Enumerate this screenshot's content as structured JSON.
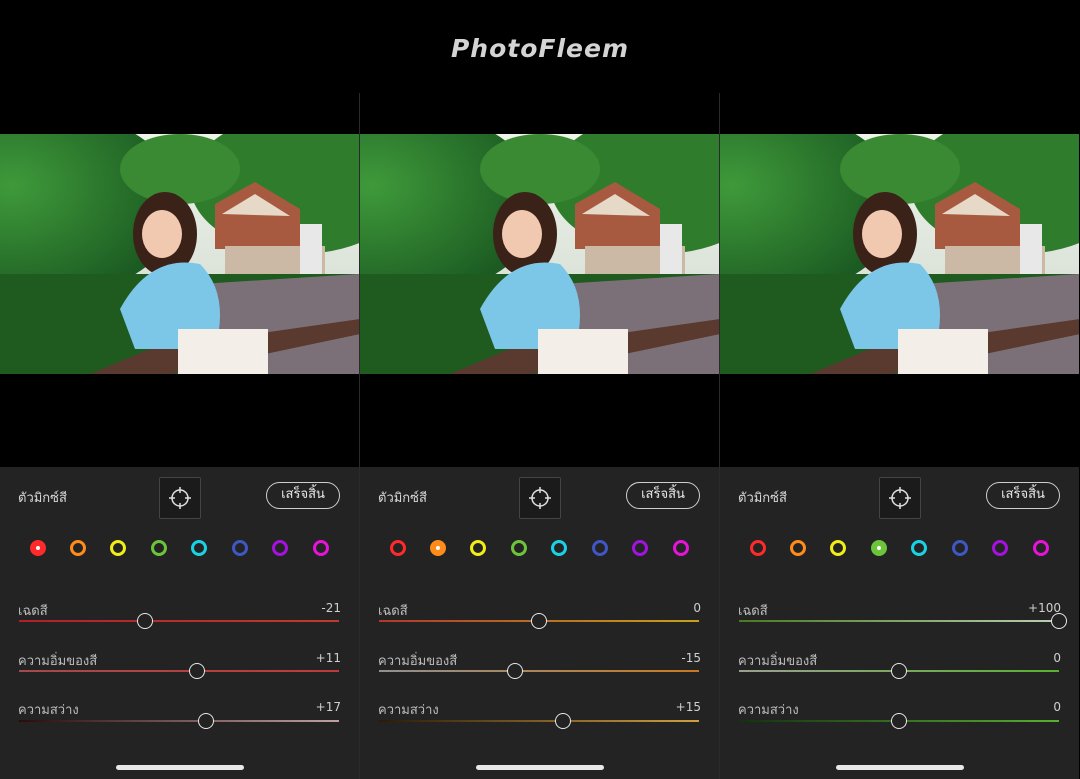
{
  "brand": "PhotoFleem",
  "panels": [
    {
      "header": {
        "label": "ตัวมิกซ์สี",
        "done_label": "เสร็จสิ้น"
      },
      "selected_color": 0,
      "sliders": [
        {
          "label": "เฉดสี",
          "value": "-21",
          "level": -21
        },
        {
          "label": "ความอิ่มของสี",
          "value": "+11",
          "level": 11
        },
        {
          "label": "ความสว่าง",
          "value": "+17",
          "level": 17
        }
      ]
    },
    {
      "header": {
        "label": "ตัวมิกซ์สี",
        "done_label": "เสร็จสิ้น"
      },
      "selected_color": 1,
      "sliders": [
        {
          "label": "เฉดสี",
          "value": "0",
          "level": 0
        },
        {
          "label": "ความอิ่มของสี",
          "value": "-15",
          "level": -15
        },
        {
          "label": "ความสว่าง",
          "value": "+15",
          "level": 15
        }
      ]
    },
    {
      "header": {
        "label": "ตัวมิกซ์สี",
        "done_label": "เสร็จสิ้น"
      },
      "selected_color": 3,
      "sliders": [
        {
          "label": "เฉดสี",
          "value": "+100",
          "level": 100
        },
        {
          "label": "ความอิ่มของสี",
          "value": "0",
          "level": 0
        },
        {
          "label": "ความสว่าง",
          "value": "0",
          "level": 0
        }
      ]
    }
  ],
  "color_swatches": [
    {
      "name": "red",
      "color": "#ff2a2a"
    },
    {
      "name": "orange",
      "color": "#ff8c1a"
    },
    {
      "name": "yellow",
      "color": "#f2ee16"
    },
    {
      "name": "green",
      "color": "#6cc43a"
    },
    {
      "name": "aqua",
      "color": "#19d2e6"
    },
    {
      "name": "blue",
      "color": "#3f56c4"
    },
    {
      "name": "purple",
      "color": "#a313e0"
    },
    {
      "name": "magenta",
      "color": "#e514d9"
    }
  ],
  "track_colors": [
    [
      [
        "#b0202a",
        "#c13a2a"
      ],
      [
        "#a44a4a",
        "#c03a3a"
      ],
      [
        "#2b0b0b",
        "#c0a0a0"
      ]
    ],
    [
      [
        "#b0382a",
        "#c6a21a"
      ],
      [
        "#909090",
        "#c87a1e"
      ],
      [
        "#2a1a08",
        "#d0a040"
      ]
    ],
    [
      [
        "#4a7a20",
        "#b8d0b0"
      ],
      [
        "#9aa090",
        "#58b030"
      ],
      [
        "#143010",
        "#58b030"
      ]
    ]
  ],
  "icons": {
    "target": "target-icon",
    "photo": "portrait-photo"
  }
}
